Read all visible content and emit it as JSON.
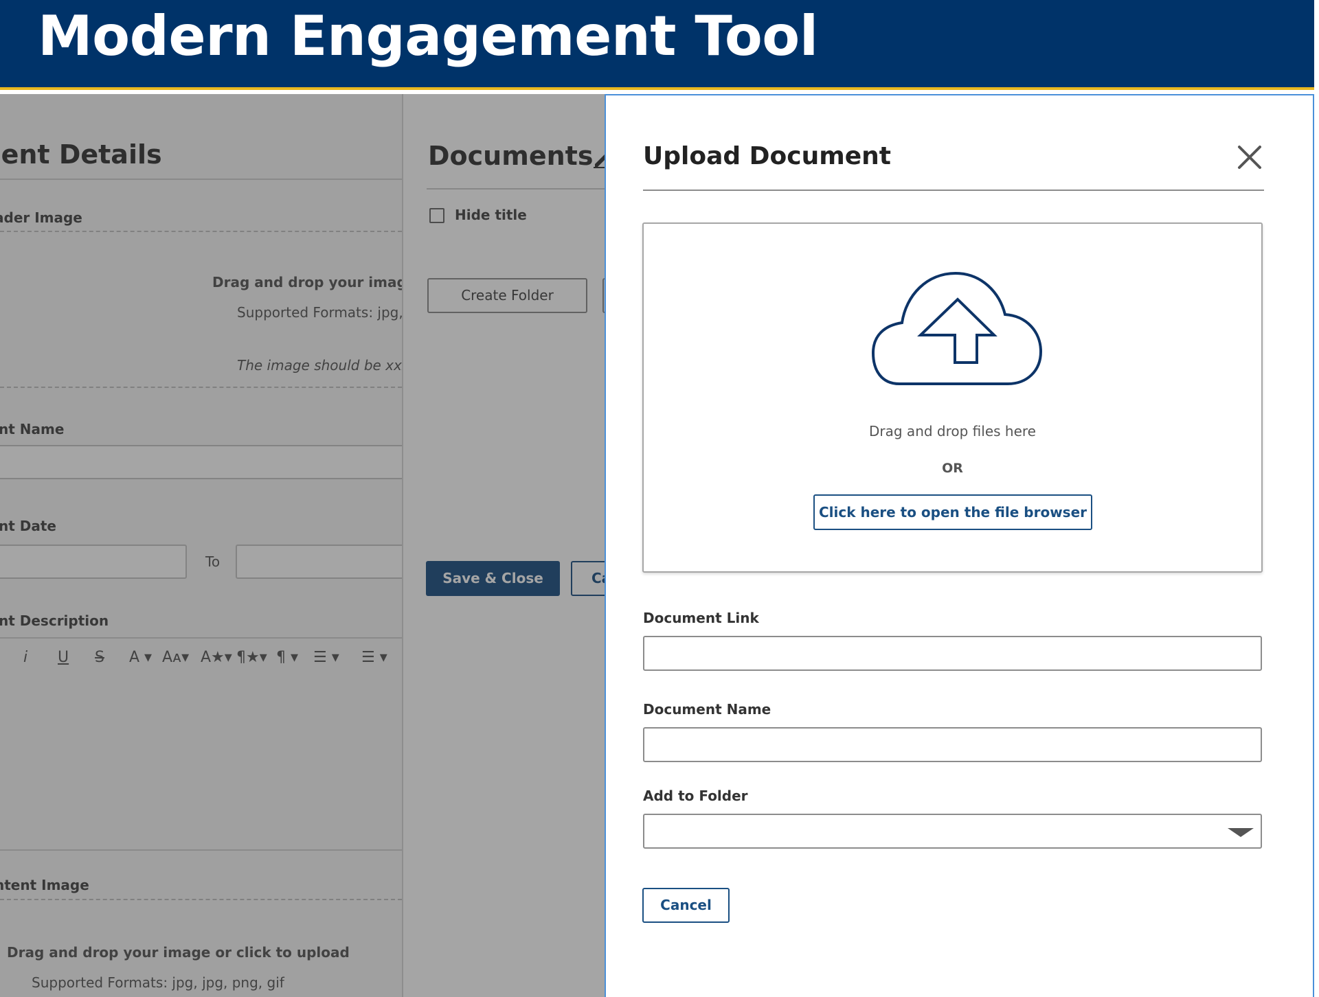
{
  "app": {
    "title": "Modern Engagement Tool"
  },
  "colors": {
    "header_bg": "#003369",
    "header_accent": "#e8b81f",
    "primary": "#1a4f82",
    "modal_border": "#4a90d9"
  },
  "background_panel": {
    "heading": "ment Details",
    "header_image_label": "ader Image",
    "dropzone_text": "Drag and drop your image o",
    "formats_text": "Supported Formats: jpg,",
    "size_hint": "The image should be xxx p",
    "name_label": "nt Name",
    "date_label": "nt Date",
    "date_to": "To",
    "description_label": "nt Description",
    "toolbar": [
      "i",
      "U",
      "S",
      "A ▾",
      "Aᴀ▾",
      "A★▾",
      "¶★▾",
      "¶ ▾",
      "☰ ▾",
      "☰ ▾"
    ],
    "content_image_label": "ntent Image",
    "dropzone_text_2": "Drag and drop your image or click to upload",
    "formats_text_2": "Supported Formats: jpg, jpg, png, gif"
  },
  "documents_panel": {
    "heading": "Documents",
    "hide_title_label": "Hide title",
    "create_folder_label": "Create Folder",
    "save_close_label": "Save & Close",
    "cancel_label_partial": "Ca"
  },
  "modal": {
    "title": "Upload Document",
    "dropzone": {
      "icon": "cloud-upload-icon",
      "drag_text": "Drag and drop files here",
      "or_text": "OR",
      "browse_label": "Click here to open the file browser"
    },
    "fields": {
      "document_link": {
        "label": "Document Link",
        "value": ""
      },
      "document_name": {
        "label": "Document Name",
        "value": ""
      },
      "add_to_folder": {
        "label": "Add to Folder",
        "value": ""
      }
    },
    "cancel_label": "Cancel"
  }
}
